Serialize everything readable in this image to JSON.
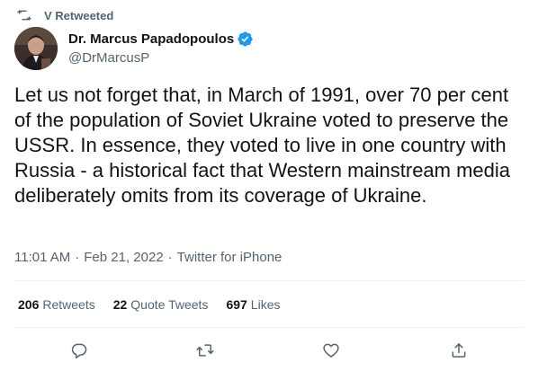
{
  "retweet_banner": {
    "icon": "retweet-icon",
    "text": "V Retweeted"
  },
  "author": {
    "display_name": "Dr. Marcus Papadopoulos",
    "handle": "@DrMarcusP",
    "verified": true,
    "verified_color": "#1d9bf0"
  },
  "tweet": {
    "text": "Let us not forget that, in March of 1991, over 70 per cent of the population of Soviet Ukraine voted to preserve the USSR. In essence, they voted to live in one country with Russia - a historical fact that Western mainstream media deliberately omits from its coverage of Ukraine."
  },
  "meta": {
    "time": "11:01 AM",
    "date": "Feb 21, 2022",
    "source": "Twitter for iPhone",
    "separator": "·"
  },
  "stats": {
    "retweets": {
      "count": "206",
      "label": "Retweets"
    },
    "quote_tweets": {
      "count": "22",
      "label": "Quote Tweets"
    },
    "likes": {
      "count": "697",
      "label": "Likes"
    }
  },
  "actions": [
    {
      "name": "reply",
      "icon": "reply-icon"
    },
    {
      "name": "retweet",
      "icon": "retweet-icon"
    },
    {
      "name": "like",
      "icon": "heart-icon"
    },
    {
      "name": "share",
      "icon": "share-icon"
    }
  ],
  "colors": {
    "text": "#0f1419",
    "secondary": "#536471",
    "divider": "#eff3f4"
  }
}
